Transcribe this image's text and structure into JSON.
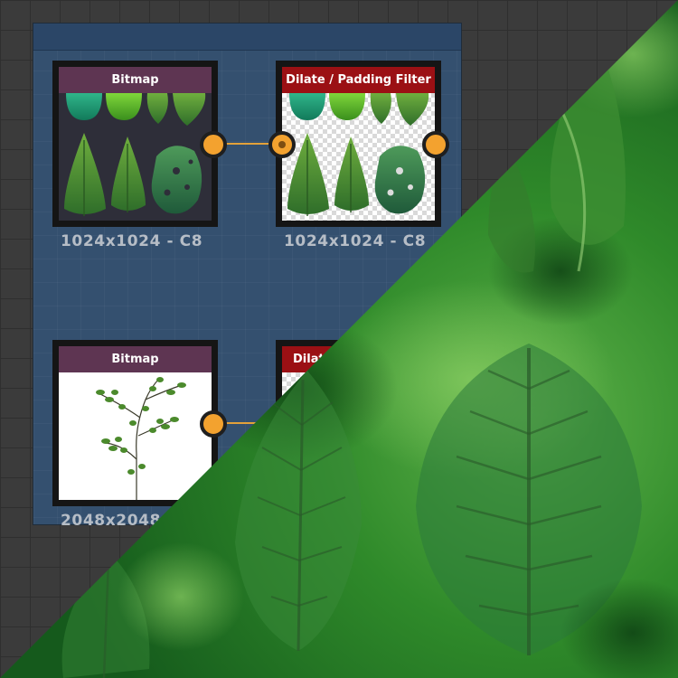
{
  "graph": {
    "nodes": [
      {
        "title": "Bitmap",
        "size_label": "1024x1024 - C8",
        "preview": "leaf-atlas"
      },
      {
        "title": "Dilate / Padding Filter",
        "size_label": "1024x1024 - C8",
        "preview": "leaf-atlas-dilated"
      },
      {
        "title": "Bitmap",
        "size_label": "2048x2048",
        "preview": "branch"
      },
      {
        "title": "Dilate / Padding Filter",
        "preview": "hidden-by-overlay"
      }
    ],
    "connections": [
      {
        "from": 0,
        "to": 1
      },
      {
        "from": 2,
        "to": 3
      }
    ]
  },
  "colors": {
    "canvas_bg": "#3b3b3b",
    "frame_bg": "#34506f",
    "bitmap_title": "#5e3552",
    "filter_title": "#9b1014",
    "port": "#f3a22f",
    "wire": "#e3a13a",
    "size_label": "#b6bdc6"
  }
}
